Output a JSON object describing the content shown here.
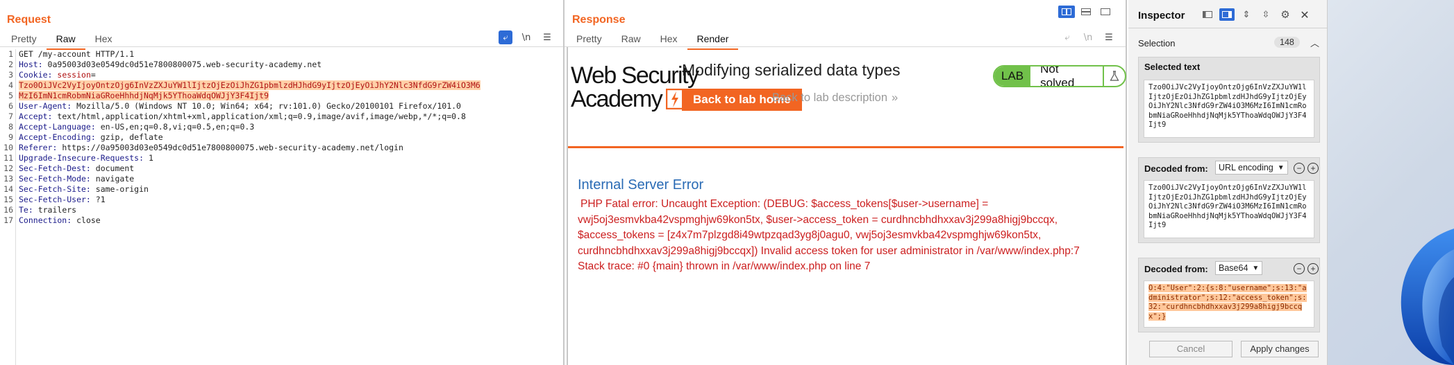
{
  "request": {
    "title": "Request",
    "tabs": [
      "Pretty",
      "Raw",
      "Hex"
    ],
    "active_tab": "Raw",
    "line_numbers": [
      "1",
      "2",
      "3",
      "",
      "",
      "4",
      "5",
      "6",
      "7",
      "8",
      "9",
      "10",
      "11",
      "12",
      "13",
      "14",
      "15",
      "16",
      "17"
    ],
    "lines": [
      {
        "plain": "GET /my-account HTTP/1.1"
      },
      {
        "name": "Host:",
        "value": " 0a95003d03e0549dc0d51e7800800075.web-security-academy.net"
      },
      {
        "name": "Cookie:",
        "value": " ",
        "cookie_name": "session",
        "cookie_eq": "="
      },
      {
        "hl": "Tzo0OiJVc2VyIjoyOntzOjg6InVzZXJuYW1lIjtzOjEzOiJhZG1pbmlzdHJhdG9yIjtzOjEyOiJhY2Nlc3NfdG9rZW4iO3M6"
      },
      {
        "hl": "MzI6ImN1cmRobmNiaGRoeHhhdjNqMjk5YThoaWdqOWJjY3F4Ijt9"
      },
      {
        "name": "User-Agent:",
        "value": " Mozilla/5.0 (Windows NT 10.0; Win64; x64; rv:101.0) Gecko/20100101 Firefox/101.0"
      },
      {
        "name": "Accept:",
        "value": " text/html,application/xhtml+xml,application/xml;q=0.9,image/avif,image/webp,*/*;q=0.8"
      },
      {
        "name": "Accept-Language:",
        "value": " en-US,en;q=0.8,vi;q=0.5,en;q=0.3"
      },
      {
        "name": "Accept-Encoding:",
        "value": " gzip, deflate"
      },
      {
        "name": "Referer:",
        "value": " https://0a95003d03e0549dc0d51e7800800075.web-security-academy.net/login"
      },
      {
        "name": "Upgrade-Insecure-Requests:",
        "value": " 1"
      },
      {
        "name": "Sec-Fetch-Dest:",
        "value": " document"
      },
      {
        "name": "Sec-Fetch-Mode:",
        "value": " navigate"
      },
      {
        "name": "Sec-Fetch-Site:",
        "value": " same-origin"
      },
      {
        "name": "Sec-Fetch-User:",
        "value": " ?1"
      },
      {
        "name": "Te:",
        "value": " trailers"
      },
      {
        "name": "Connection:",
        "value": " close"
      },
      {
        "plain": ""
      },
      {
        "plain": ""
      }
    ],
    "toolbar": {
      "newline_label": "\\n",
      "menu_icon": "hamburger-icon",
      "wrap_icon": "wrap-icon"
    }
  },
  "response": {
    "title": "Response",
    "tabs": [
      "Pretty",
      "Raw",
      "Hex",
      "Render"
    ],
    "active_tab": "Render",
    "toolbar": {
      "newline_label": "\\n"
    },
    "render": {
      "logo_line1": "Web Security",
      "logo_line2": "Academy",
      "lab_title": "Modifying serialized data types",
      "back_home": "Back to lab home",
      "back_desc": "Back to lab description",
      "back_desc_chevron": "»",
      "lab_label": "LAB",
      "lab_status": "Not solved",
      "error_title": "Internal Server Error",
      "error_lines": [
        "PHP Fatal error: Uncaught Exception: (DEBUG: $access_tokens[$user->username] =",
        "vwj5oj3esmvkba42vspmghjw69kon5tx, $user->access_token = curdhncbhdhxxav3j299a8higj9bccqx,",
        "$access_tokens = [z4x7m7plzgd8i49wtpzqad3yg8j0agu0, vwj5oj3esmvkba42vspmghjw69kon5tx,",
        "curdhncbhdhxxav3j299a8higj9bccqx]) Invalid access token for user administrator in /var/www/index.php:7",
        "Stack trace: #0 {main} thrown in /var/www/index.php on line 7"
      ]
    },
    "colors": {
      "accent": "#f26522",
      "lab_green": "#71c14a",
      "error_red": "#cc1f1f",
      "link_blue": "#2a6bb5"
    }
  },
  "inspector": {
    "title": "Inspector",
    "selection_label": "Selection",
    "selection_count": "148",
    "selected_text_label": "Selected text",
    "selected_text": "Tzo0OiJVc2VyIjoyOntzOjg6InVzZXJuYW1lIjtzOjEzOiJhZG1pbmlzdHJhdG9yIjtzOjEyOiJhY2Nlc3NfdG9rZW4iO3M6MzI6ImN1cmRobmNiaGRoeHhhdjNqMjk5YThoaWdqOWJjY3F4Ijt9",
    "decoded1_label": "Decoded from:",
    "decoded1_select": "URL encoding",
    "decoded1_text": "Tzo0OiJVc2VyIjoyOntzOjg6InVzZXJuYW1lIjtzOjEzOiJhZG1pbmlzdHJhdG9yIjtzOjEyOiJhY2Nlc3NfdG9rZW4iO3M6MzI6ImN1cmRobmNiaGRoeHhhdjNqMjk5YThoaWdqOWJjY3F4Ijt9",
    "decoded2_label": "Decoded from:",
    "decoded2_select": "Base64",
    "decoded2_text": "O:4:\"User\":2:{s:8:\"username\";s:13:\"administrator\";s:12:\"access_token\";s:32:\"curdhncbhdhxxav3j299a8higj9bccqx\";}",
    "cancel": "Cancel",
    "apply": "Apply changes"
  }
}
